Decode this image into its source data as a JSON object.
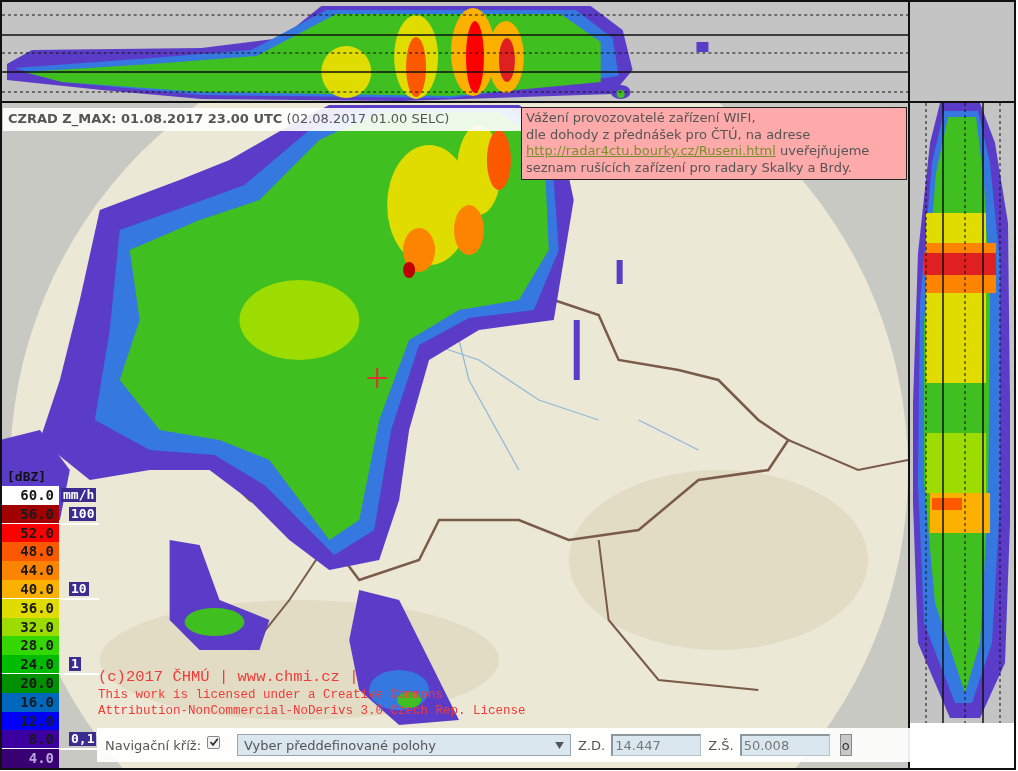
{
  "title": "**CZRAD Z_MAX: 01.08.2017 23.00 UTC** (02.08.2017 01.00 SELC)",
  "notice": {
    "text_before": "Vážení provozovatelé zařízení WIFI,\ndle dohody z přednášek pro ČTÚ, na adrese",
    "link": "http://radar4ctu.bourky.cz/Ruseni.html",
    "text_after": "uveřejňujeme\nseznam rušících zařízení pro radary Skalky a Brdy."
  },
  "legend": {
    "unit": "[dBZ]",
    "rate_unit": "mm/h",
    "steps": [
      {
        "label": "60.0",
        "color": "#ffffff"
      },
      {
        "label": "56.0",
        "color": "#a00000",
        "rate": "100"
      },
      {
        "label": "52.0",
        "color": "#fc0000"
      },
      {
        "label": "48.0",
        "color": "#fc5800"
      },
      {
        "label": "44.0",
        "color": "#fc8400"
      },
      {
        "label": "40.0",
        "color": "#fcb000",
        "rate": "10"
      },
      {
        "label": "36.0",
        "color": "#e0dc00"
      },
      {
        "label": "32.0",
        "color": "#9cdc00"
      },
      {
        "label": "28.0",
        "color": "#34d800"
      },
      {
        "label": "24.0",
        "color": "#00bc00",
        "rate": "1"
      },
      {
        "label": "20.0",
        "color": "#009000"
      },
      {
        "label": "16.0",
        "color": "#0068bc"
      },
      {
        "label": "12.0",
        "color": "#0000fc"
      },
      {
        "label": "8.0",
        "color": "#3c00a0",
        "rate": "0,1"
      },
      {
        "label": "4.0",
        "color": "#380070"
      }
    ]
  },
  "copyright": {
    "notice": "(c)2017 ČHMÚ | www.chmi.cz |",
    "license": "This work is licensed under a Creative Commons Attribution-NonCommercial-NoDerivs 3.0 Czech Rep. License"
  },
  "navigation": {
    "label": "Navigační kříž:",
    "checked": true,
    "preset": "Vyber předdefinované polohy",
    "lon_label": "Z.D.",
    "lon": "14.447",
    "lat_label": "Z.Š.",
    "lat": "50.008",
    "button": "o"
  }
}
